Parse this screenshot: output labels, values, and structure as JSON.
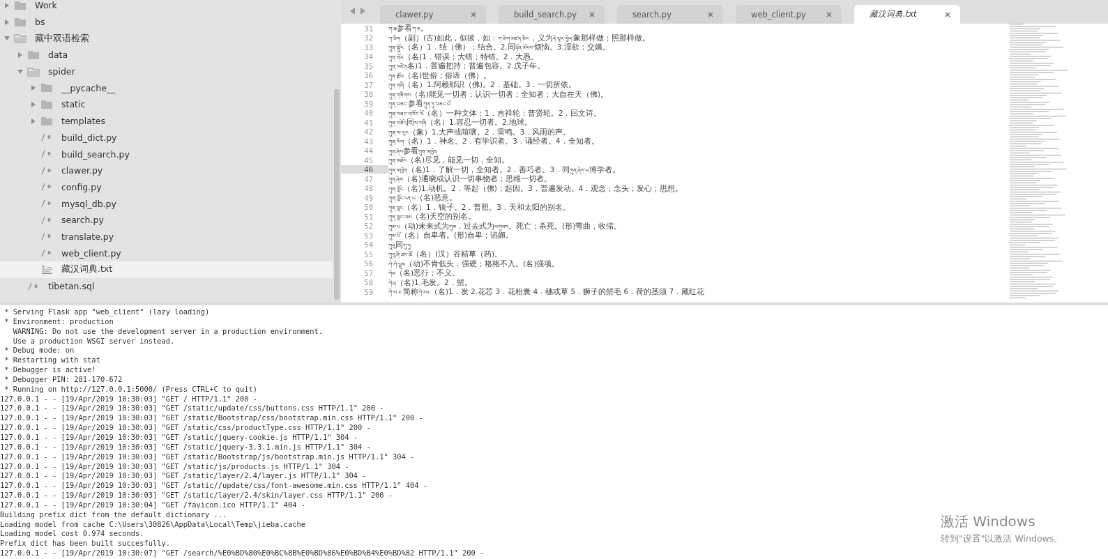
{
  "sidebar": {
    "tree": [
      {
        "label": "Work",
        "kind": "folder",
        "expanded": false,
        "selected": false
      },
      {
        "label": "bs",
        "kind": "folder",
        "expanded": false,
        "selected": false
      },
      {
        "label": "藏中双语检索",
        "kind": "folder",
        "expanded": true,
        "selected": false,
        "children": [
          {
            "label": "data",
            "kind": "folder",
            "expanded": false,
            "selected": false
          },
          {
            "label": "spider",
            "kind": "folder",
            "expanded": true,
            "selected": false,
            "children": [
              {
                "label": "__pycache__",
                "kind": "folder",
                "expanded": false,
                "selected": false
              },
              {
                "label": "static",
                "kind": "folder",
                "expanded": false,
                "selected": false
              },
              {
                "label": "templates",
                "kind": "folder",
                "expanded": false,
                "selected": false
              },
              {
                "label": "build_dict.py",
                "kind": "code",
                "selected": false
              },
              {
                "label": "build_search.py",
                "kind": "code",
                "selected": false
              },
              {
                "label": "clawer.py",
                "kind": "code",
                "selected": false
              },
              {
                "label": "config.py",
                "kind": "code",
                "selected": false
              },
              {
                "label": "mysql_db.py",
                "kind": "code",
                "selected": false
              },
              {
                "label": "search.py",
                "kind": "code",
                "selected": false
              },
              {
                "label": "translate.py",
                "kind": "code",
                "selected": false
              },
              {
                "label": "web_client.py",
                "kind": "code",
                "selected": false
              },
              {
                "label": "藏汉词典.txt",
                "kind": "text",
                "selected": true
              }
            ]
          },
          {
            "label": "tibetan.sql",
            "kind": "code",
            "selected": false
          }
        ]
      }
    ]
  },
  "tabs": [
    {
      "label": "clawer.py",
      "selected": false
    },
    {
      "label": "build_search.py",
      "selected": false
    },
    {
      "label": "search.py",
      "selected": false
    },
    {
      "label": "web_client.py",
      "selected": false
    },
    {
      "label": "藏汉词典.txt",
      "selected": true
    }
  ],
  "editor": {
    "lines": [
      {
        "number": "31",
        "text": "ཀ་ཆ参看ཀ་ཅ。",
        "current": false
      },
      {
        "number": "32",
        "text": "ཀ་ཅིག（副）(古)如此，似彼，如：ཀ་ཅིག་མཛད་ཅིང་，义为དེ་ལྟར་བྱེད་象那样做；照那样做。",
        "current": false
      },
      {
        "number": "33",
        "text": "ཀུན་སྦྱོར（名）1．结（佛）；结合。2.同ཉོན་མོངས་烦恼。3.淫欲；交媾。",
        "current": false
      },
      {
        "number": "34",
        "text": "ཀུན་ནོར（名)1．错误；大错；特错。2．大愚。",
        "current": false
      },
      {
        "number": "35",
        "text": "ཀུན་འཛིན名)1．普遍把持；普遍包容。2.戊子年。",
        "current": false
      },
      {
        "number": "36",
        "text": "ཀུན་རྫོབ（名)世俗；俗谛（佛）。",
        "current": false
      },
      {
        "number": "37",
        "text": "ཀུན་གཞི（名）1.阿赖耶识（佛)。2．基础。3．一切所依。",
        "current": false
      },
      {
        "number": "38",
        "text": "ཀུན་གཟིགས（名)能见一切者；认识一切者；全知者；大自在天（佛)。",
        "current": false
      },
      {
        "number": "39",
        "text": "ཀུན་བཟང་参看ཀུན་ཏུ་བཟང་པོ",
        "current": false
      },
      {
        "number": "40",
        "text": "ཀུན་བཟང་འཁོར་ལོ（名）一种文体：1．吉祥轮；普贤轮。2．回文诗。",
        "current": false
      },
      {
        "number": "41",
        "text": "ཀུན་བཟོད同ས་གཞི（名）1.容忍一切者。2.地球。",
        "current": false
      },
      {
        "number": "42",
        "text": "ཀུན་ལ་འུར（象）1.大声或喧嚷。2．雷鸣。3．风雨的声。",
        "current": false
      },
      {
        "number": "43",
        "text": "ཀུན་རིག（名）1．神名。2．有学识者。3．诵经者。4．全知者。",
        "current": false
      },
      {
        "number": "44",
        "text": "ཀུན་ཤེས参看ཀུན་མཁྱེན",
        "current": false
      },
      {
        "number": "45",
        "text": "ཀུན་མཐོང（名)尽见，能见一切，全知。",
        "current": false
      },
      {
        "number": "46",
        "text": "ཀུན་མཁྱེན（名)1．了解一切，全知者。2．善巧者。3．同ཀུན་ཤེས་པ博学者。",
        "current": true
      },
      {
        "number": "47",
        "text": "ཀུན་ཤེས（名)通晓或认识一切事物者；思维一切者。",
        "current": false
      },
      {
        "number": "48",
        "text": "ཀུན་སློང（名)1.动机。2．等起（佛)；起因。3．普遍发动。4．观念；念头；发心；思想。",
        "current": false
      },
      {
        "number": "49",
        "text": "ཀུན་སློང་ངན་པ（名)恶意。",
        "current": false
      },
      {
        "number": "50",
        "text": "ཀུན་སྣང（名）1．镜子。2．普照。3．天和太阳的别名。",
        "current": false
      },
      {
        "number": "51",
        "text": "ཀུན་སྣང་ལམ（名)天空的别名。",
        "current": false
      },
      {
        "number": "52",
        "text": "ཀུམ་པ（动)未来式为ཀུམ，过去式为བཀུམས。死亡；杀死。(形)弯曲，收缩。",
        "current": false
      },
      {
        "number": "53",
        "text": "ཀུམ་པོ（名）自卑者。(形)自卑；谄媚。",
        "current": false
      },
      {
        "number": "54",
        "text": "ཀུའུ同ཀུ་ཏུ",
        "current": false
      },
      {
        "number": "55",
        "text": "ཀུའུ་ཤི་ཚང་ཚོ（名）(汉）谷精草（药)。",
        "current": false
      },
      {
        "number": "56",
        "text": "ཀེ་ཀེ་ལྡུམ（动)不肯低头，强硬；格格不入。(名)强项。",
        "current": false
      },
      {
        "number": "57",
        "text": "ཀེལ（名)恶行；不义。",
        "current": false
      },
      {
        "number": "58",
        "text": "ཀེ་ཤ（名)1.毛发。2．鬃。",
        "current": false
      },
      {
        "number": "59",
        "text": "ཀེ་ས་ར་简称ཀེ་སར（名)1．发 2.花芯 3．花粉囊 4．穗或草 5．狮子的鬃毛 6．荷的茎须 7．藏红花",
        "current": false
      }
    ]
  },
  "console": {
    "lines": [
      " * Serving Flask app \"web_client\" (lazy loading)",
      " * Environment: production",
      "   WARNING: Do not use the development server in a production environment.",
      "   Use a production WSGI server instead.",
      " * Debug mode: on",
      " * Restarting with stat",
      " * Debugger is active!",
      " * Debugger PIN: 281-170-672",
      " * Running on http://127.0.0.1:5000/ (Press CTRL+C to quit)",
      "127.0.0.1 - - [19/Apr/2019 10:30:03] \"GET / HTTP/1.1\" 200 -",
      "127.0.0.1 - - [19/Apr/2019 10:30:03] \"GET /static/update/css/buttons.css HTTP/1.1\" 200 -",
      "127.0.0.1 - - [19/Apr/2019 10:30:03] \"GET /static/Bootstrap/css/bootstrap.min.css HTTP/1.1\" 200 -",
      "127.0.0.1 - - [19/Apr/2019 10:30:03] \"GET /static/css/productType.css HTTP/1.1\" 200 -",
      "127.0.0.1 - - [19/Apr/2019 10:30:03] \"GET /static/jquery-cookie.js HTTP/1.1\" 304 -",
      "127.0.0.1 - - [19/Apr/2019 10:30:03] \"GET /static/jquery-3.3.1.min.js HTTP/1.1\" 304 -",
      "127.0.0.1 - - [19/Apr/2019 10:30:03] \"GET /static/Bootstrap/js/bootstrap.min.js HTTP/1.1\" 304 -",
      "127.0.0.1 - - [19/Apr/2019 10:30:03] \"GET /static/js/products.js HTTP/1.1\" 304 -",
      "127.0.0.1 - - [19/Apr/2019 10:30:03] \"GET /static/layer/2.4/layer.js HTTP/1.1\" 304 -",
      "127.0.0.1 - - [19/Apr/2019 10:30:03] \"GET /static//update/css/font-awesome.min.css HTTP/1.1\" 404 -",
      "127.0.0.1 - - [19/Apr/2019 10:30:03] \"GET /static/layer/2.4/skin/layer.css HTTP/1.1\" 200 -",
      "127.0.0.1 - - [19/Apr/2019 10:30:04] \"GET /favicon.ico HTTP/1.1\" 404 -",
      "Building prefix dict from the default dictionary ...",
      "Loading model from cache C:\\Users\\30826\\AppData\\Local\\Temp\\jieba.cache",
      "Loading model cost 0.974 seconds.",
      "Prefix dict has been built succesfully.",
      "127.0.0.1 - - [19/Apr/2019 10:30:07] \"GET /search/%E0%BD%80%E0%BC%8B%E0%BD%86%E0%BD%B4%E0%BD%82 HTTP/1.1\" 200 -"
    ]
  },
  "activation_notice": {
    "title": "激活 Windows",
    "subtitle": "转到\"设置\"以激活 Windows。"
  }
}
